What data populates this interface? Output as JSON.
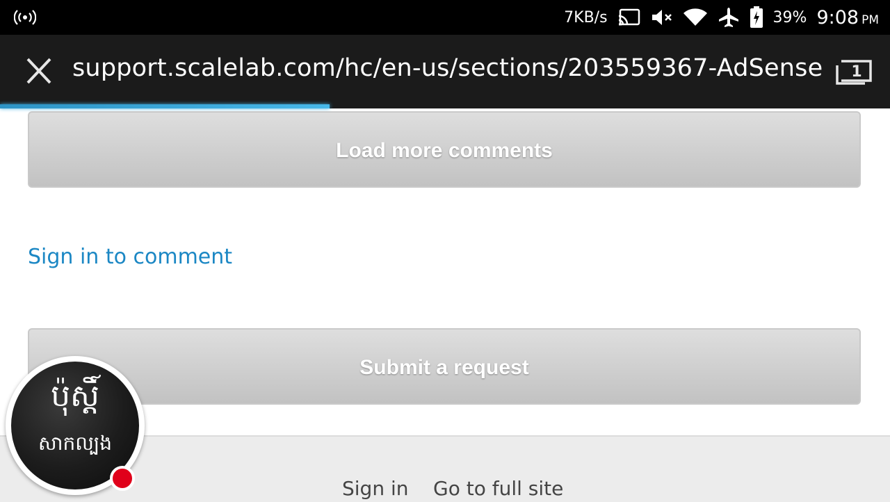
{
  "status_bar": {
    "speed": "7KB/s",
    "battery": "39%",
    "time": "9:08",
    "ampm": "PM",
    "icons": [
      "hotspot-icon",
      "cast-icon",
      "mute-icon",
      "wifi-icon",
      "airplane-icon",
      "battery-charging-icon"
    ]
  },
  "browser": {
    "url": "support.scalelab.com/hc/en-us/sections/203559367-AdSense",
    "tab_count": "1",
    "load_progress": 0.37,
    "accent": "#3fb0e4"
  },
  "content": {
    "load_more_label": "Load more comments",
    "sign_in_comment": "Sign in to comment",
    "submit_request_label": "Submit a request",
    "link_color": "#1b87c4"
  },
  "footer": {
    "sign_in": "Sign in",
    "full_site": "Go to full site"
  },
  "bubble": {
    "line1": "ប៉ុស្តិ៍",
    "line2": "សាកល្បង",
    "notification_color": "#e0001a"
  }
}
